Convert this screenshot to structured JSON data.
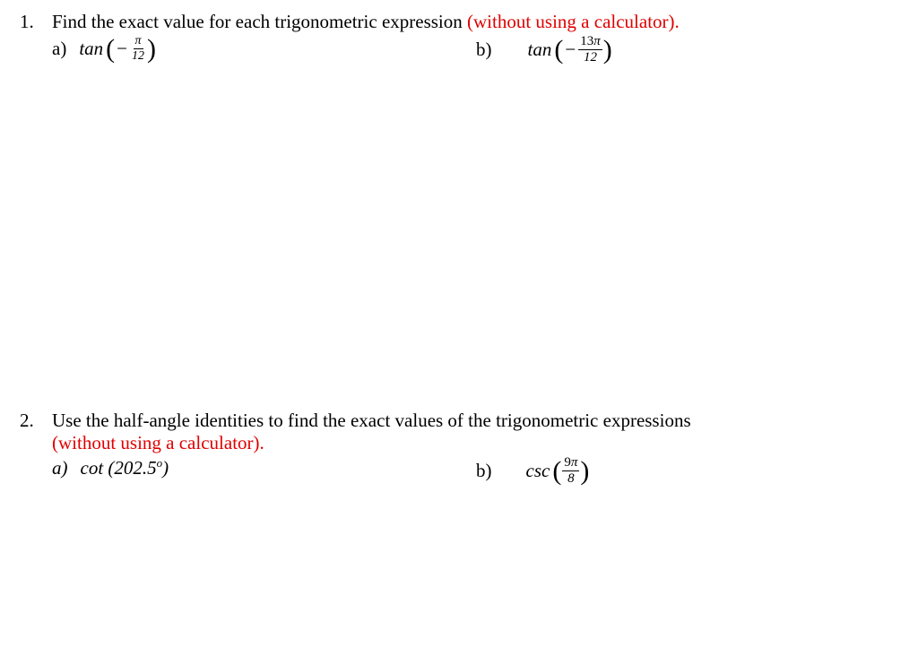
{
  "problem1": {
    "number": "1.",
    "text_plain": "Find the exact value for each trigonometric expression ",
    "text_red": "(without using a calculator).",
    "a": {
      "label": "a)",
      "func": "tan",
      "minus": "−",
      "numer": "π",
      "denom": "12"
    },
    "b": {
      "label": "b)",
      "func": "tan",
      "minus": "−",
      "numer": "13π",
      "denom": "12"
    }
  },
  "problem2": {
    "number": "2.",
    "text_plain": "Use the half-angle identities to find the exact values of the trigonometric expressions ",
    "text_red": "(without using a calculator).",
    "a": {
      "label": "a)",
      "func": "cot",
      "inner": "(202.5",
      "degree": "o",
      "close": ")"
    },
    "b": {
      "label": "b)",
      "func": "csc",
      "numer": "9π",
      "denom": "8"
    }
  }
}
